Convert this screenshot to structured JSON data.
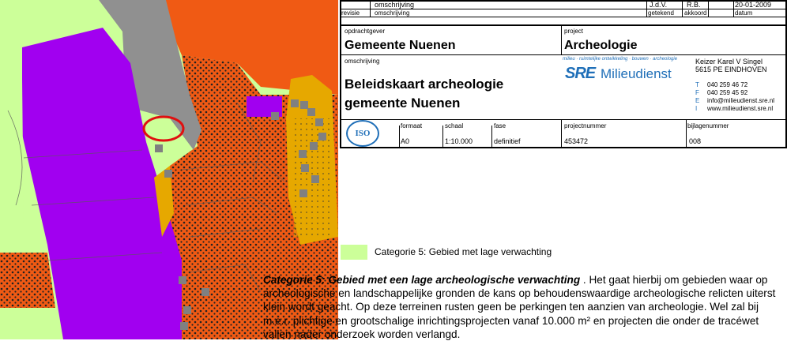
{
  "title_block": {
    "row1": {
      "omschrijving": "omschrijving",
      "drawn_by": "J.d.V.",
      "approved_by": "R.B.",
      "date": "20-01-2009"
    },
    "row1_labels": {
      "revisie": "revisie",
      "omschrijving": "omschrijving",
      "getekend": "getekend",
      "akkoord": "akkoord",
      "datum": "datum"
    },
    "opdrachtgever_label": "opdrachtgever",
    "opdrachtgever": "Gemeente Nuenen",
    "project_label": "project",
    "project": "Archeologie",
    "omschrijving_label": "omschrijving",
    "omschrijving_line1": "Beleidskaart archeologie",
    "omschrijving_line2": "gemeente Nuenen",
    "sre_tagline": "milieu · ruimtelijke ontwikkeling · bouwen · archeologie",
    "sre_logo_text": "SRE",
    "sre_name": "Milieudienst",
    "address_line1": "Keizer Karel V Singel",
    "address_line2": "5615 PE  EINDHOVEN",
    "contact": [
      {
        "prefix": "T",
        "value": "040 259 46 72"
      },
      {
        "prefix": "F",
        "value": "040 259 45 92"
      },
      {
        "prefix": "E",
        "value": "info@milieudienst.sre.nl"
      },
      {
        "prefix": "I",
        "value": "www.milieudienst.sre.nl"
      }
    ],
    "iso_label": "ISO",
    "formaat_label": "formaat",
    "formaat": "A0",
    "schaal_label": "schaal",
    "schaal": "1:10.000",
    "fase_label": "fase",
    "fase": "definitief",
    "projectnummer_label": "projectnummer",
    "projectnummer": "453472",
    "bijlagenummer_label": "bijlagenummer",
    "bijlagenummer": "008"
  },
  "legend": {
    "label": "Categorie 5: Gebied met lage verwachting",
    "color": "#ccff99"
  },
  "description": {
    "heading": "Categorie 5:  Gebied met een lage archeologische verwachting",
    "body": " . Het gaat hierbij om gebieden waar op archeologische en landschappelijke gronden de kans op behoudenswaardige archeologische relicten uiterst klein wordt geacht. Op deze terreinen rusten geen be    perkingen ten aanzien van archeologie. Wel zal bij m.e.r. plichtige en grootschalige inrichtingsprojecten vanaf 10.000 m² en projecten die onder de tracéwet vallen nader onderzoek worden verlangd."
  },
  "map_colors": {
    "low_expectation": "#ccff99",
    "high_expectation": "#f05a14",
    "purple_zone": "#a100f0",
    "yellow_zone": "#e6a800",
    "built_area": "#909090",
    "marker": "#e01010"
  }
}
